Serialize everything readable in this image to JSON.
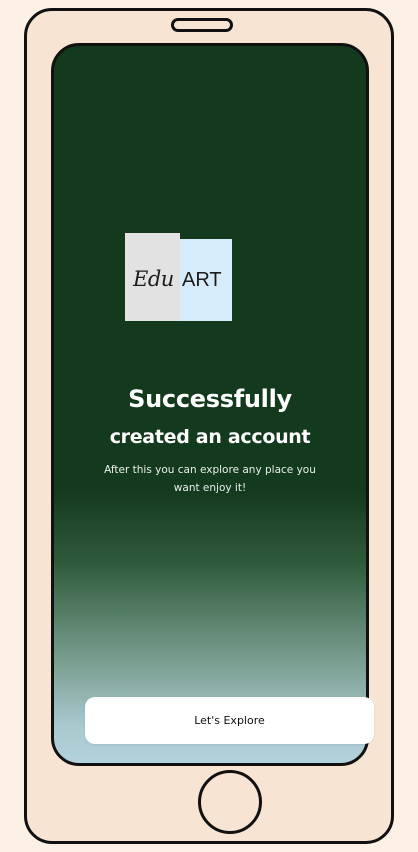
{
  "colors": {
    "page_background": "#fdf0e4",
    "phone_body": "#f8e4d2",
    "screen_top": "#143a1e",
    "screen_bottom": "#b3d2dc",
    "logo_left_panel": "#e2e2e2",
    "logo_right_panel": "#d6ecfb",
    "button_background": "#ffffff"
  },
  "logo": {
    "script_text": "Edu",
    "block_text": "ART"
  },
  "success": {
    "title": "Successfully",
    "subtitle": "created an account",
    "description_line1": "After this you can explore any place you",
    "description_line2": "want enjoy it!"
  },
  "cta": {
    "label": "Let's Explore"
  },
  "icons": {
    "speaker": "speaker-slot-icon",
    "home": "home-button-icon"
  }
}
